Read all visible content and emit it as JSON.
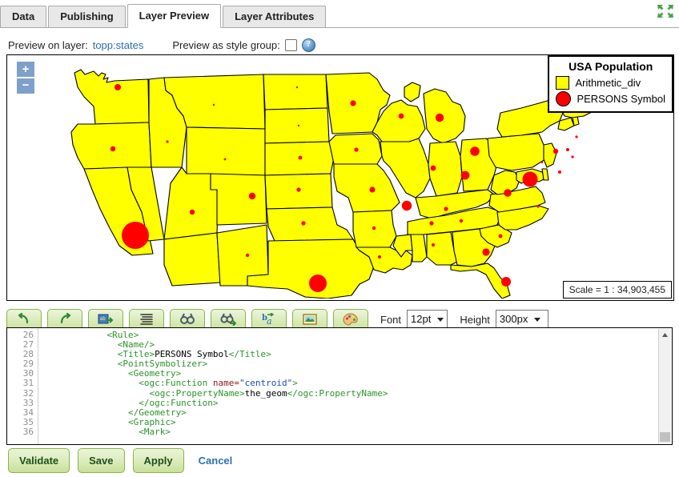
{
  "tabs": [
    {
      "label": "Data",
      "active": false
    },
    {
      "label": "Publishing",
      "active": false
    },
    {
      "label": "Layer Preview",
      "active": true
    },
    {
      "label": "Layer Attributes",
      "active": false
    }
  ],
  "window": {
    "expand_icon": "expand-arrows-icon"
  },
  "preview_bar": {
    "layer_label": "Preview on layer:",
    "layer_name": "topp:states",
    "style_group_label": "Preview as style group:",
    "checkbox_checked": false,
    "help_glyph": "?"
  },
  "map": {
    "zoom_in": "+",
    "zoom_out": "−",
    "scale_text": "Scale = 1 : 34,903,455",
    "legend": {
      "title": "USA Population",
      "entries": [
        {
          "symbol": "square",
          "label": "Arithmetic_div",
          "color": "#ffff00"
        },
        {
          "symbol": "circle",
          "label": "PERSONS Symbol",
          "color": "#ff0000"
        }
      ]
    },
    "colors": {
      "fill": "#ffff00",
      "stroke": "#000000",
      "point": "#ff0000",
      "background": "#ffffff"
    }
  },
  "toolbar": {
    "buttons": [
      {
        "name": "undo-icon",
        "title": "Undo"
      },
      {
        "name": "redo-icon",
        "title": "Redo"
      },
      {
        "name": "insert-image-icon",
        "title": "Insert image"
      },
      {
        "name": "format-lines-icon",
        "title": "Format"
      },
      {
        "name": "find-icon",
        "title": "Find"
      },
      {
        "name": "find-replace-icon",
        "title": "Find and replace"
      },
      {
        "name": "font-style-icon",
        "title": "Font style"
      },
      {
        "name": "picture-icon",
        "title": "Picture"
      },
      {
        "name": "palette-icon",
        "title": "Color palette"
      }
    ],
    "font_label": "Font",
    "font_value": "12pt",
    "height_label": "Height",
    "height_value": "300px"
  },
  "editor": {
    "first_line": 26,
    "lines": [
      {
        "n": 26,
        "segments": [
          {
            "t": "tg",
            "s": "            <Rule>"
          }
        ]
      },
      {
        "n": 27,
        "segments": [
          {
            "t": "tg",
            "s": "              <Name/>"
          }
        ]
      },
      {
        "n": 28,
        "segments": [
          {
            "t": "tg",
            "s": "              <Title>"
          },
          {
            "t": "tx",
            "s": "PERSONS Symbol"
          },
          {
            "t": "tg",
            "s": "</Title>"
          }
        ]
      },
      {
        "n": 29,
        "segments": [
          {
            "t": "tg",
            "s": "              <PointSymbolizer>"
          }
        ]
      },
      {
        "n": 30,
        "segments": [
          {
            "t": "tg",
            "s": "                <Geometry>"
          }
        ]
      },
      {
        "n": 31,
        "segments": [
          {
            "t": "tg",
            "s": "                  <ogc:Function "
          },
          {
            "t": "at",
            "s": "name="
          },
          {
            "t": "av",
            "s": "\"centroid\""
          },
          {
            "t": "tg",
            "s": ">"
          }
        ]
      },
      {
        "n": 32,
        "segments": [
          {
            "t": "tg",
            "s": "                    <ogc:PropertyName>"
          },
          {
            "t": "tx",
            "s": "the_geom"
          },
          {
            "t": "tg",
            "s": "</ogc:PropertyName>"
          }
        ]
      },
      {
        "n": 33,
        "segments": [
          {
            "t": "tg",
            "s": "                  </ogc:Function>"
          }
        ]
      },
      {
        "n": 34,
        "segments": [
          {
            "t": "tg",
            "s": "                </Geometry>"
          }
        ]
      },
      {
        "n": 35,
        "segments": [
          {
            "t": "tg",
            "s": "                <Graphic>"
          }
        ]
      },
      {
        "n": 36,
        "segments": [
          {
            "t": "tg",
            "s": "                  <Mark>"
          }
        ]
      }
    ],
    "scrollbar": {
      "up_arrow": "▲"
    }
  },
  "footer": {
    "validate": "Validate",
    "save": "Save",
    "apply": "Apply",
    "cancel": "Cancel"
  }
}
